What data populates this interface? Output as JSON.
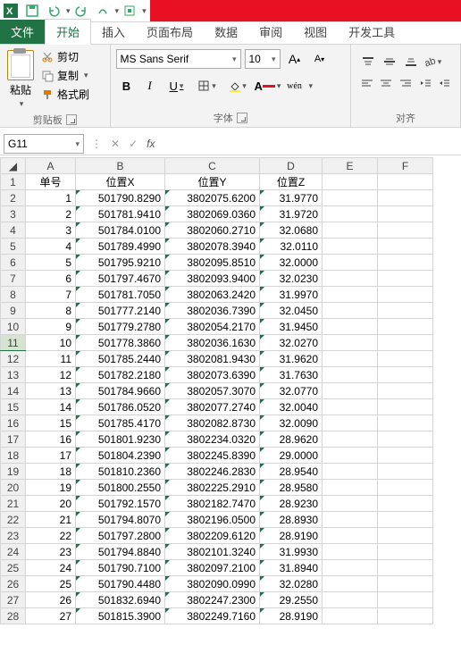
{
  "qat": {
    "app_icon": "excel",
    "icons": [
      "save",
      "undo",
      "redo",
      "quick-print",
      "touch"
    ]
  },
  "tabs": {
    "file": "文件",
    "items": [
      "开始",
      "插入",
      "页面布局",
      "数据",
      "审阅",
      "视图",
      "开发工具"
    ],
    "active": 0
  },
  "ribbon": {
    "clipboard": {
      "paste": "粘贴",
      "cut": "剪切",
      "copy": "复制",
      "format_painter": "格式刷",
      "label": "剪贴板"
    },
    "font": {
      "name": "MS Sans Serif",
      "size": "10",
      "label": "字体",
      "bold": "B",
      "italic": "I",
      "underline": "U",
      "grow": "A",
      "shrink": "A"
    },
    "align": {
      "label": "对齐"
    }
  },
  "namebox": "G11",
  "columns": [
    "A",
    "B",
    "C",
    "D",
    "E",
    "F"
  ],
  "headers": {
    "A": "单号",
    "B": "位置X",
    "C": "位置Y",
    "D": "位置Z"
  },
  "selected_row": 11,
  "rows": [
    {
      "n": 1
    },
    {
      "n": 2,
      "A": "1",
      "B": "501790.8290",
      "C": "3802075.6200",
      "D": "31.9770"
    },
    {
      "n": 3,
      "A": "2",
      "B": "501781.9410",
      "C": "3802069.0360",
      "D": "31.9720"
    },
    {
      "n": 4,
      "A": "3",
      "B": "501784.0100",
      "C": "3802060.2710",
      "D": "32.0680"
    },
    {
      "n": 5,
      "A": "4",
      "B": "501789.4990",
      "C": "3802078.3940",
      "D": "32.0110"
    },
    {
      "n": 6,
      "A": "5",
      "B": "501795.9210",
      "C": "3802095.8510",
      "D": "32.0000"
    },
    {
      "n": 7,
      "A": "6",
      "B": "501797.4670",
      "C": "3802093.9400",
      "D": "32.0230"
    },
    {
      "n": 8,
      "A": "7",
      "B": "501781.7050",
      "C": "3802063.2420",
      "D": "31.9970"
    },
    {
      "n": 9,
      "A": "8",
      "B": "501777.2140",
      "C": "3802036.7390",
      "D": "32.0450"
    },
    {
      "n": 10,
      "A": "9",
      "B": "501779.2780",
      "C": "3802054.2170",
      "D": "31.9450"
    },
    {
      "n": 11,
      "A": "10",
      "B": "501778.3860",
      "C": "3802036.1630",
      "D": "32.0270"
    },
    {
      "n": 12,
      "A": "11",
      "B": "501785.2440",
      "C": "3802081.9430",
      "D": "31.9620"
    },
    {
      "n": 13,
      "A": "12",
      "B": "501782.2180",
      "C": "3802073.6390",
      "D": "31.7630"
    },
    {
      "n": 14,
      "A": "13",
      "B": "501784.9660",
      "C": "3802057.3070",
      "D": "32.0770"
    },
    {
      "n": 15,
      "A": "14",
      "B": "501786.0520",
      "C": "3802077.2740",
      "D": "32.0040"
    },
    {
      "n": 16,
      "A": "15",
      "B": "501785.4170",
      "C": "3802082.8730",
      "D": "32.0090"
    },
    {
      "n": 17,
      "A": "16",
      "B": "501801.9230",
      "C": "3802234.0320",
      "D": "28.9620"
    },
    {
      "n": 18,
      "A": "17",
      "B": "501804.2390",
      "C": "3802245.8390",
      "D": "29.0000"
    },
    {
      "n": 19,
      "A": "18",
      "B": "501810.2360",
      "C": "3802246.2830",
      "D": "28.9540"
    },
    {
      "n": 20,
      "A": "19",
      "B": "501800.2550",
      "C": "3802225.2910",
      "D": "28.9580"
    },
    {
      "n": 21,
      "A": "20",
      "B": "501792.1570",
      "C": "3802182.7470",
      "D": "28.9230"
    },
    {
      "n": 22,
      "A": "21",
      "B": "501794.8070",
      "C": "3802196.0500",
      "D": "28.8930"
    },
    {
      "n": 23,
      "A": "22",
      "B": "501797.2800",
      "C": "3802209.6120",
      "D": "28.9190"
    },
    {
      "n": 24,
      "A": "23",
      "B": "501794.8840",
      "C": "3802101.3240",
      "D": "31.9930"
    },
    {
      "n": 25,
      "A": "24",
      "B": "501790.7100",
      "C": "3802097.2100",
      "D": "31.8940"
    },
    {
      "n": 26,
      "A": "25",
      "B": "501790.4480",
      "C": "3802090.0990",
      "D": "32.0280"
    },
    {
      "n": 27,
      "A": "26",
      "B": "501832.6940",
      "C": "3802247.2300",
      "D": "29.2550"
    },
    {
      "n": 28,
      "A": "27",
      "B": "501815.3900",
      "C": "3802249.7160",
      "D": "28.9190"
    }
  ]
}
